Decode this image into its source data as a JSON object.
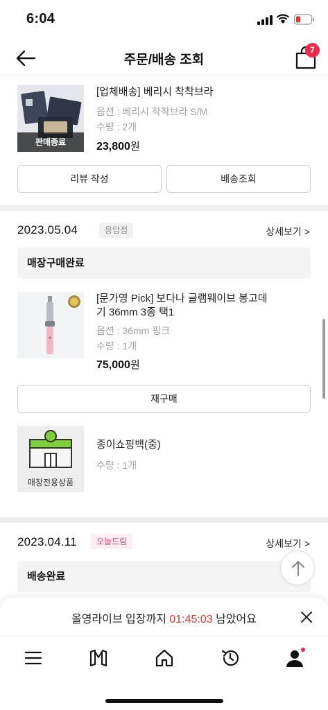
{
  "status_bar": {
    "time": "6:04"
  },
  "header": {
    "title": "주문/배송 조회",
    "cart_count": "7"
  },
  "orders": [
    {
      "items": [
        {
          "name": "[업체배송] 베리시 착착브라",
          "option": "옵션 : 베리시 착착브라 S/M",
          "qty": "수량 : 2개",
          "price": "23,800",
          "won": "원",
          "thumb_label": "판매종료"
        }
      ],
      "buttons": {
        "review": "리뷰 작성",
        "tracking": "배송조회"
      }
    },
    {
      "date": "2023.05.04",
      "store": "응암점",
      "detail": "상세보기 >",
      "status": "매장구매완료",
      "items": [
        {
          "name_line1": "[문가영 Pick] 보다나 글램웨이브 봉고데",
          "name_line2": "기 36mm 3종 택1",
          "option": "옵션 : 36mm 핑크",
          "qty": "수량 : 1개",
          "price": "75,000",
          "won": "원"
        },
        {
          "name": "종이쇼핑백(중)",
          "qty": "수량 : 1개",
          "thumb_label": "매장전용상품"
        }
      ],
      "buttons": {
        "rebuy": "재구매"
      }
    },
    {
      "date": "2023.04.11",
      "store": "오늘드림",
      "detail": "상세보기 >",
      "status": "배송완료"
    }
  ],
  "live_banner": {
    "prefix": "올영라이브 입장까지 ",
    "timer": "01:45:03",
    "suffix": " 남았어요"
  },
  "bottom_nav": {
    "items": [
      "menu-icon",
      "brand-icon",
      "home-icon",
      "history-icon",
      "my-page-icon"
    ]
  },
  "colors": {
    "badge": "#ec2b4f",
    "timer": "#e8322f",
    "today_tag": "#e0457b"
  }
}
